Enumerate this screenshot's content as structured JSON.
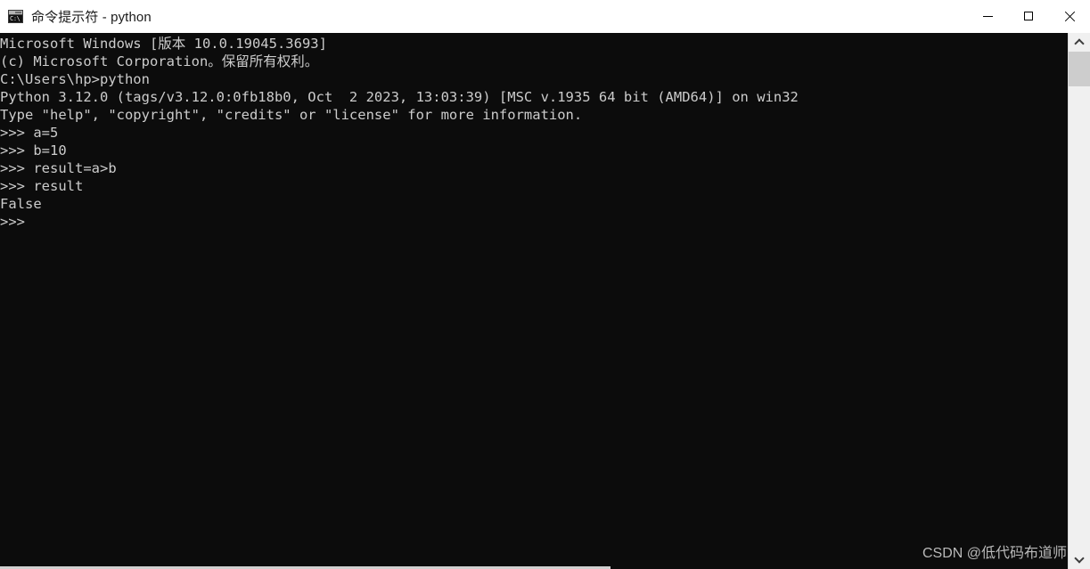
{
  "window": {
    "title": "命令提示符 - python",
    "icon_name": "cmd-icon",
    "icon_text": "C:\\",
    "background_color": "#0c0c0c",
    "text_color": "#cccccc",
    "titlebar_color": "#ffffff"
  },
  "window_buttons": {
    "minimize_label": "—",
    "maximize_label": "□",
    "close_label": "✕"
  },
  "console": {
    "lines": [
      "Microsoft Windows [版本 10.0.19045.3693]",
      "(c) Microsoft Corporation。保留所有权利。",
      "",
      "C:\\Users\\hp>python",
      "Python 3.12.0 (tags/v3.12.0:0fb18b0, Oct  2 2023, 13:03:39) [MSC v.1935 64 bit (AMD64)] on win32",
      "Type \"help\", \"copyright\", \"credits\" or \"license\" for more information.",
      ">>> a=5",
      ">>> b=10",
      ">>> result=a>b",
      ">>> result",
      "False",
      ">>> "
    ]
  },
  "scrollbar": {
    "up_arrow": "▲",
    "down_arrow": "▼",
    "thumb_label": "scroll-thumb"
  },
  "watermark": {
    "text": "CSDN @低代码布道师"
  }
}
